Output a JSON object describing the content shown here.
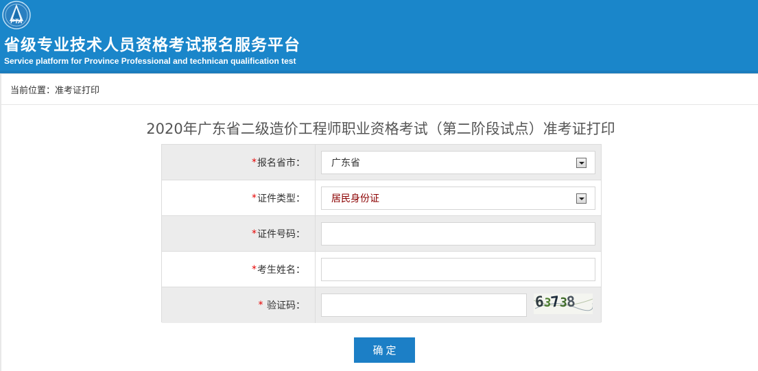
{
  "header": {
    "logo_text": "PTA",
    "title": "省级专业技术人员资格考试报名服务平台",
    "subtitle": "Service platform for Province Professional and technican qualification test",
    "background_color": "#1a86ca"
  },
  "breadcrumb": {
    "text": "当前位置：准考证打印"
  },
  "page_title": "2020年广东省二级造价工程师职业资格考试（第二阶段试点）准考证打印",
  "form": {
    "required_mark": "*",
    "province": {
      "label": "报名省市：",
      "selected": "广东省"
    },
    "id_type": {
      "label": "证件类型：",
      "selected": "居民身份证"
    },
    "id_number": {
      "label": "证件号码：",
      "value": ""
    },
    "candidate_name": {
      "label": "考生姓名：",
      "value": ""
    },
    "captcha": {
      "label": " 验证码：",
      "value": "",
      "image_digits": [
        "6",
        "3",
        "7",
        "3",
        "8"
      ]
    }
  },
  "submit_label": "确定",
  "accent_color": "#1c7fc6"
}
